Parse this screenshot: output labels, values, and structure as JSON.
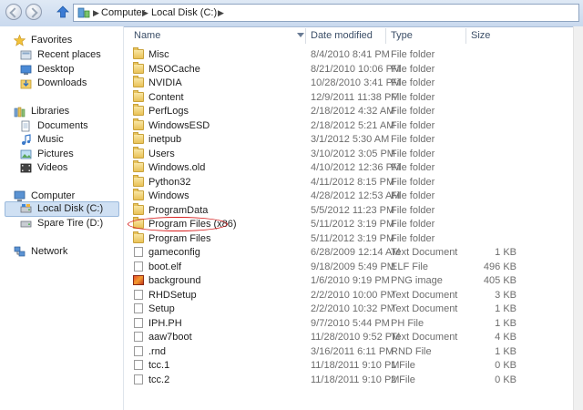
{
  "address_bar": {
    "crumbs": [
      "Computer",
      "Local Disk (C:)"
    ]
  },
  "nav_pane": {
    "favorites": {
      "label": "Favorites",
      "items": [
        "Recent places",
        "Desktop",
        "Downloads"
      ]
    },
    "libraries": {
      "label": "Libraries",
      "items": [
        "Documents",
        "Music",
        "Pictures",
        "Videos"
      ]
    },
    "computer": {
      "label": "Computer",
      "items": [
        "Local Disk (C:)",
        "Spare Tire (D:)"
      ]
    },
    "network": {
      "label": "Network"
    },
    "selected_item": "Local Disk (C:)"
  },
  "columns": {
    "name": "Name",
    "date": "Date modified",
    "type": "Type",
    "size": "Size"
  },
  "files": [
    {
      "name": "Misc",
      "date": "8/4/2010 8:41 PM",
      "type": "File folder",
      "size": "",
      "icon": "folder-icon"
    },
    {
      "name": "MSOCache",
      "date": "8/21/2010 10:06 PM",
      "type": "File folder",
      "size": "",
      "icon": "folder-icon"
    },
    {
      "name": "NVIDIA",
      "date": "10/28/2010 3:41 PM",
      "type": "File folder",
      "size": "",
      "icon": "folder-icon"
    },
    {
      "name": "Content",
      "date": "12/9/2011 11:38 PM",
      "type": "File folder",
      "size": "",
      "icon": "folder-icon"
    },
    {
      "name": "PerfLogs",
      "date": "2/18/2012 4:32 AM",
      "type": "File folder",
      "size": "",
      "icon": "folder-icon"
    },
    {
      "name": "WindowsESD",
      "date": "2/18/2012 5:21 AM",
      "type": "File folder",
      "size": "",
      "icon": "folder-icon"
    },
    {
      "name": "inetpub",
      "date": "3/1/2012 5:30 AM",
      "type": "File folder",
      "size": "",
      "icon": "folder-icon"
    },
    {
      "name": "Users",
      "date": "3/10/2012 3:05 PM",
      "type": "File folder",
      "size": "",
      "icon": "folder-icon"
    },
    {
      "name": "Windows.old",
      "date": "4/10/2012 12:36 PM",
      "type": "File folder",
      "size": "",
      "icon": "folder-icon"
    },
    {
      "name": "Python32",
      "date": "4/11/2012 8:15 PM",
      "type": "File folder",
      "size": "",
      "icon": "folder-icon"
    },
    {
      "name": "Windows",
      "date": "4/28/2012 12:53 AM",
      "type": "File folder",
      "size": "",
      "icon": "folder-icon"
    },
    {
      "name": "ProgramData",
      "date": "5/5/2012 11:23 PM",
      "type": "File folder",
      "size": "",
      "icon": "folder-icon"
    },
    {
      "name": "Program Files (x86)",
      "date": "5/11/2012 3:19 PM",
      "type": "File folder",
      "size": "",
      "icon": "folder-icon",
      "circled": true
    },
    {
      "name": "Program Files",
      "date": "5/11/2012 3:19 PM",
      "type": "File folder",
      "size": "",
      "icon": "folder-icon"
    },
    {
      "name": "gameconfig",
      "date": "6/28/2009 12:14 AM",
      "type": "Text Document",
      "size": "1 KB",
      "icon": "file-icon"
    },
    {
      "name": "boot.elf",
      "date": "9/18/2009 5:49 PM",
      "type": "ELF File",
      "size": "496 KB",
      "icon": "file-icon"
    },
    {
      "name": "background",
      "date": "1/6/2010 9:19 PM",
      "type": "PNG image",
      "size": "405 KB",
      "icon": "image-icon"
    },
    {
      "name": "RHDSetup",
      "date": "2/2/2010 10:00 PM",
      "type": "Text Document",
      "size": "3 KB",
      "icon": "file-icon"
    },
    {
      "name": "Setup",
      "date": "2/2/2010 10:32 PM",
      "type": "Text Document",
      "size": "1 KB",
      "icon": "file-icon"
    },
    {
      "name": "IPH.PH",
      "date": "9/7/2010 5:44 PM",
      "type": "PH File",
      "size": "1 KB",
      "icon": "file-icon"
    },
    {
      "name": "aaw7boot",
      "date": "11/28/2010 9:52 PM",
      "type": "Text Document",
      "size": "4 KB",
      "icon": "file-icon"
    },
    {
      "name": ".rnd",
      "date": "3/16/2011 6:11 PM",
      "type": "RND File",
      "size": "1 KB",
      "icon": "file-icon"
    },
    {
      "name": "tcc.1",
      "date": "11/18/2011 9:10 PM",
      "type": "1 File",
      "size": "0 KB",
      "icon": "file-icon"
    },
    {
      "name": "tcc.2",
      "date": "11/18/2011 9:10 PM",
      "type": "2 File",
      "size": "0 KB",
      "icon": "file-icon"
    }
  ],
  "colors": {
    "highlight_circle": "#d81e1e",
    "selection": "#cfe0f3",
    "header_text": "#3c4f68"
  }
}
